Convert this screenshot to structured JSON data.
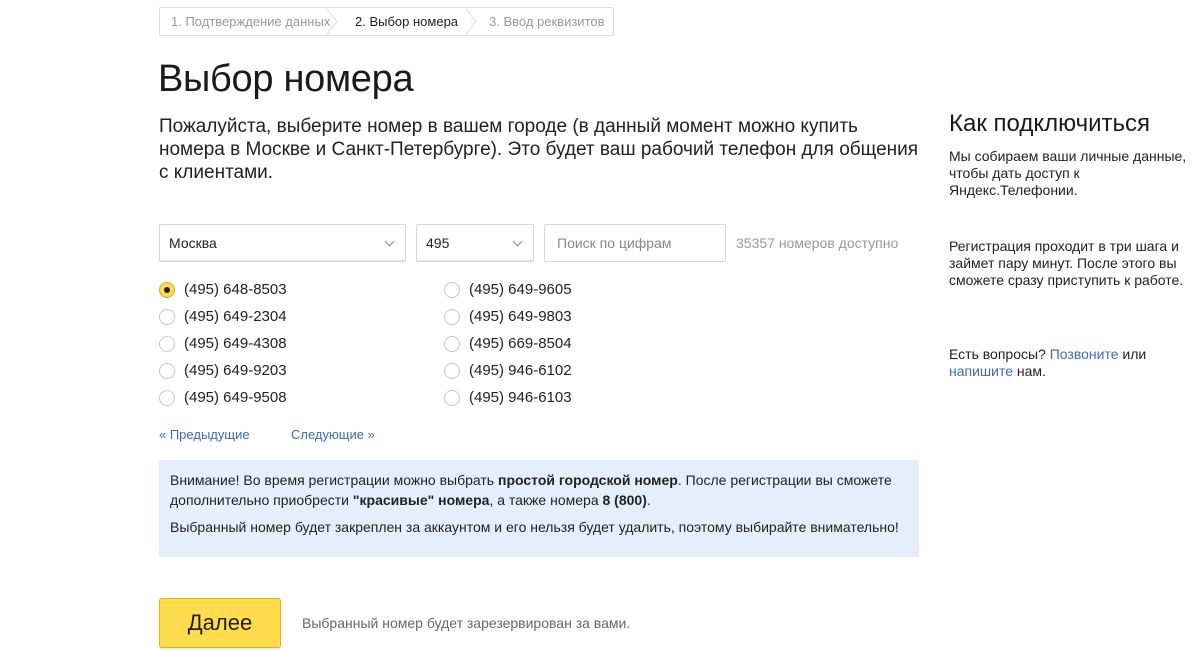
{
  "steps": [
    {
      "label": "1. Подтверждение данных"
    },
    {
      "label": "2. Выбор номера"
    },
    {
      "label": "3. Ввод реквизитов"
    }
  ],
  "page_title": "Выбор номера",
  "intro": "Пожалуйста, выберите номер в вашем городе (в данный момент можно купить номера в Москве и Санкт-Петербурге). Это будет ваш рабочий телефон для общения с клиентами.",
  "filters": {
    "city": "Москва",
    "code": "495",
    "search_placeholder": "Поиск по цифрам",
    "available": "35357 номеров доступно"
  },
  "numbers": {
    "col1": [
      "(495) 648-8503",
      "(495) 649-2304",
      "(495) 649-4308",
      "(495) 649-9203",
      "(495) 649-9508"
    ],
    "col2": [
      "(495) 649-9605",
      "(495) 649-9803",
      "(495) 669-8504",
      "(495) 946-6102",
      "(495) 946-6103"
    ],
    "selected": "(495) 648-8503"
  },
  "pager": {
    "prev": "« Предыдущие",
    "next": "Следующие »"
  },
  "notice": {
    "p1_a": "Внимание! Во время регистрации можно выбрать ",
    "p1_b": "простой городской номер",
    "p1_c": ". После регистрации вы сможете дополнительно приобрести ",
    "p1_d": "\"красивые\" номера",
    "p1_e": ", а также номера ",
    "p1_f": "8 (800)",
    "p1_g": ".",
    "p2": "Выбранный номер будет закреплен за аккаунтом и его нельзя будет удалить, поэтому выбирайте внимательно!"
  },
  "next_button": "Далее",
  "next_note": "Выбранный номер будет зарезервирован за вами.",
  "sidebar": {
    "title": "Как подключиться",
    "p1": "Мы собираем ваши личные данные, чтобы дать доступ к Яндекс.Телефонии.",
    "p2": "Регистрация проходит в три шага и займет пару минут. После этого вы сможете сразу приступить к работе.",
    "p3_a": "Есть вопросы? ",
    "p3_call": "Позвоните",
    "p3_b": " или ",
    "p3_write": "напишите",
    "p3_c": " нам."
  },
  "colors": {
    "accent_yellow": "#ffdb4d",
    "link_blue": "#3c6cb5",
    "notice_bg": "#e5eefc"
  }
}
